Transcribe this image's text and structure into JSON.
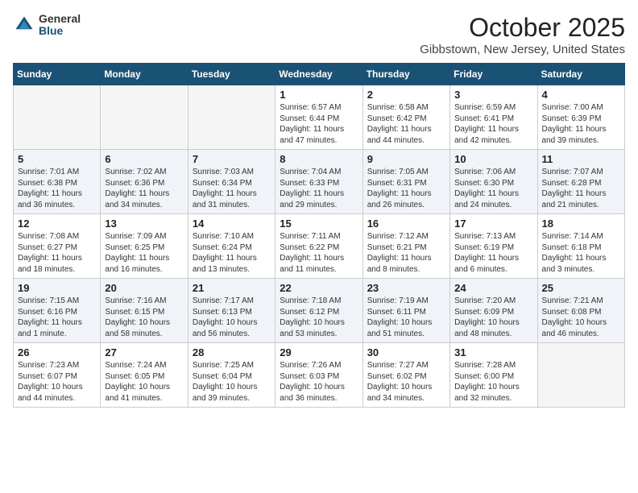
{
  "logo": {
    "general": "General",
    "blue": "Blue"
  },
  "title": "October 2025",
  "location": "Gibbstown, New Jersey, United States",
  "days_of_week": [
    "Sunday",
    "Monday",
    "Tuesday",
    "Wednesday",
    "Thursday",
    "Friday",
    "Saturday"
  ],
  "weeks": [
    [
      {
        "day": "",
        "info": ""
      },
      {
        "day": "",
        "info": ""
      },
      {
        "day": "",
        "info": ""
      },
      {
        "day": "1",
        "info": "Sunrise: 6:57 AM\nSunset: 6:44 PM\nDaylight: 11 hours\nand 47 minutes."
      },
      {
        "day": "2",
        "info": "Sunrise: 6:58 AM\nSunset: 6:42 PM\nDaylight: 11 hours\nand 44 minutes."
      },
      {
        "day": "3",
        "info": "Sunrise: 6:59 AM\nSunset: 6:41 PM\nDaylight: 11 hours\nand 42 minutes."
      },
      {
        "day": "4",
        "info": "Sunrise: 7:00 AM\nSunset: 6:39 PM\nDaylight: 11 hours\nand 39 minutes."
      }
    ],
    [
      {
        "day": "5",
        "info": "Sunrise: 7:01 AM\nSunset: 6:38 PM\nDaylight: 11 hours\nand 36 minutes."
      },
      {
        "day": "6",
        "info": "Sunrise: 7:02 AM\nSunset: 6:36 PM\nDaylight: 11 hours\nand 34 minutes."
      },
      {
        "day": "7",
        "info": "Sunrise: 7:03 AM\nSunset: 6:34 PM\nDaylight: 11 hours\nand 31 minutes."
      },
      {
        "day": "8",
        "info": "Sunrise: 7:04 AM\nSunset: 6:33 PM\nDaylight: 11 hours\nand 29 minutes."
      },
      {
        "day": "9",
        "info": "Sunrise: 7:05 AM\nSunset: 6:31 PM\nDaylight: 11 hours\nand 26 minutes."
      },
      {
        "day": "10",
        "info": "Sunrise: 7:06 AM\nSunset: 6:30 PM\nDaylight: 11 hours\nand 24 minutes."
      },
      {
        "day": "11",
        "info": "Sunrise: 7:07 AM\nSunset: 6:28 PM\nDaylight: 11 hours\nand 21 minutes."
      }
    ],
    [
      {
        "day": "12",
        "info": "Sunrise: 7:08 AM\nSunset: 6:27 PM\nDaylight: 11 hours\nand 18 minutes."
      },
      {
        "day": "13",
        "info": "Sunrise: 7:09 AM\nSunset: 6:25 PM\nDaylight: 11 hours\nand 16 minutes."
      },
      {
        "day": "14",
        "info": "Sunrise: 7:10 AM\nSunset: 6:24 PM\nDaylight: 11 hours\nand 13 minutes."
      },
      {
        "day": "15",
        "info": "Sunrise: 7:11 AM\nSunset: 6:22 PM\nDaylight: 11 hours\nand 11 minutes."
      },
      {
        "day": "16",
        "info": "Sunrise: 7:12 AM\nSunset: 6:21 PM\nDaylight: 11 hours\nand 8 minutes."
      },
      {
        "day": "17",
        "info": "Sunrise: 7:13 AM\nSunset: 6:19 PM\nDaylight: 11 hours\nand 6 minutes."
      },
      {
        "day": "18",
        "info": "Sunrise: 7:14 AM\nSunset: 6:18 PM\nDaylight: 11 hours\nand 3 minutes."
      }
    ],
    [
      {
        "day": "19",
        "info": "Sunrise: 7:15 AM\nSunset: 6:16 PM\nDaylight: 11 hours\nand 1 minute."
      },
      {
        "day": "20",
        "info": "Sunrise: 7:16 AM\nSunset: 6:15 PM\nDaylight: 10 hours\nand 58 minutes."
      },
      {
        "day": "21",
        "info": "Sunrise: 7:17 AM\nSunset: 6:13 PM\nDaylight: 10 hours\nand 56 minutes."
      },
      {
        "day": "22",
        "info": "Sunrise: 7:18 AM\nSunset: 6:12 PM\nDaylight: 10 hours\nand 53 minutes."
      },
      {
        "day": "23",
        "info": "Sunrise: 7:19 AM\nSunset: 6:11 PM\nDaylight: 10 hours\nand 51 minutes."
      },
      {
        "day": "24",
        "info": "Sunrise: 7:20 AM\nSunset: 6:09 PM\nDaylight: 10 hours\nand 48 minutes."
      },
      {
        "day": "25",
        "info": "Sunrise: 7:21 AM\nSunset: 6:08 PM\nDaylight: 10 hours\nand 46 minutes."
      }
    ],
    [
      {
        "day": "26",
        "info": "Sunrise: 7:23 AM\nSunset: 6:07 PM\nDaylight: 10 hours\nand 44 minutes."
      },
      {
        "day": "27",
        "info": "Sunrise: 7:24 AM\nSunset: 6:05 PM\nDaylight: 10 hours\nand 41 minutes."
      },
      {
        "day": "28",
        "info": "Sunrise: 7:25 AM\nSunset: 6:04 PM\nDaylight: 10 hours\nand 39 minutes."
      },
      {
        "day": "29",
        "info": "Sunrise: 7:26 AM\nSunset: 6:03 PM\nDaylight: 10 hours\nand 36 minutes."
      },
      {
        "day": "30",
        "info": "Sunrise: 7:27 AM\nSunset: 6:02 PM\nDaylight: 10 hours\nand 34 minutes."
      },
      {
        "day": "31",
        "info": "Sunrise: 7:28 AM\nSunset: 6:00 PM\nDaylight: 10 hours\nand 32 minutes."
      },
      {
        "day": "",
        "info": ""
      }
    ]
  ]
}
